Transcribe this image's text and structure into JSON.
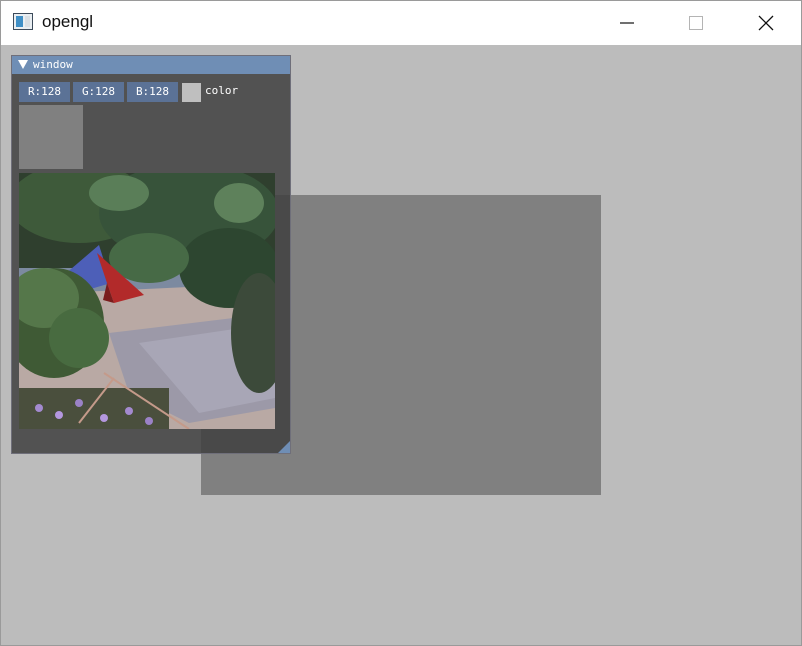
{
  "window": {
    "title": "opengl",
    "controls": [
      "minimize",
      "maximize",
      "close"
    ]
  },
  "imgui_window": {
    "title": "window",
    "color_edit": {
      "r_label": "R:128",
      "g_label": "G:128",
      "b_label": "B:128",
      "label": "color",
      "value_hex": "#808080"
    }
  },
  "colors": {
    "background": "#bcbcbc",
    "quad": "#808080",
    "imgui_title": "#6f8eb5",
    "imgui_frame": "#5b7296"
  },
  "icons": {
    "app": "opengl-app-icon",
    "collapse": "triangle-down-icon",
    "minimize": "minimize-icon",
    "maximize": "maximize-icon",
    "close": "close-icon"
  }
}
